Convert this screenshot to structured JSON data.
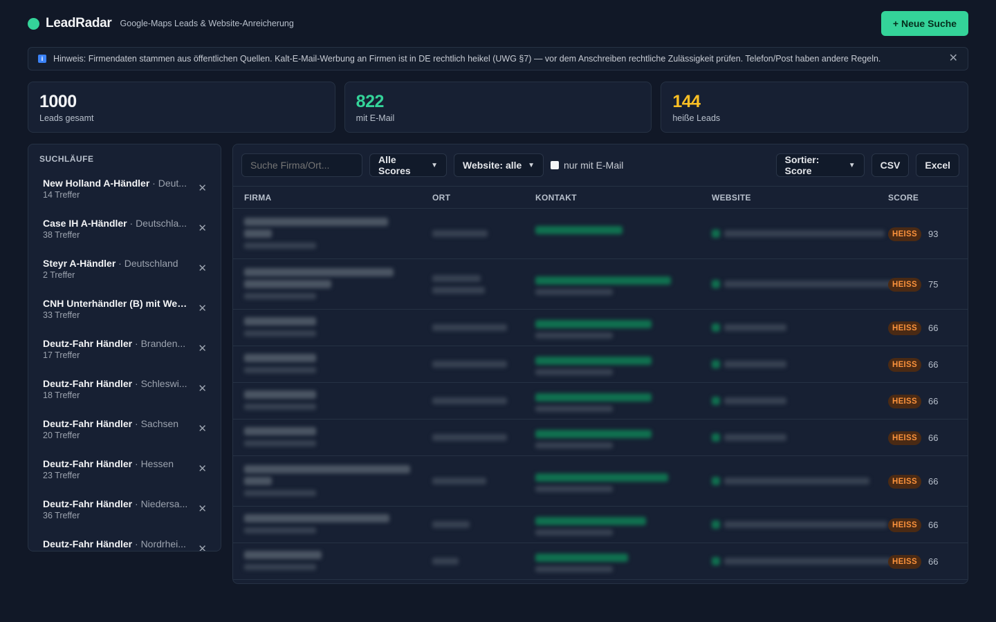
{
  "app": {
    "name": "LeadRadar",
    "subtitle": "Google-Maps Leads & Website-Anreicherung",
    "new_search_label": "+ Neue Suche"
  },
  "notice": {
    "icon": "info-icon",
    "text": "Hinweis: Firmendaten stammen aus öffentlichen Quellen. Kalt-E-Mail-Werbung an Firmen ist in DE rechtlich heikel (UWG §7) — vor dem Anschreiben rechtliche Zulässigkeit prüfen. Telefon/Post haben andere Regeln.",
    "close": "✕"
  },
  "stats": [
    {
      "value": "1000",
      "label": "Leads gesamt",
      "color": "#f3f4f6"
    },
    {
      "value": "822",
      "label": "mit E-Mail",
      "color": "#34d399"
    },
    {
      "value": "144",
      "label": "heiße Leads",
      "color": "#fbbf24"
    }
  ],
  "sidebar": {
    "title": "SUCHLÄUFE",
    "runs": [
      {
        "name": "New Holland A-Händler",
        "region": " · Deut...",
        "count": "14 Treffer"
      },
      {
        "name": "Case IH A-Händler",
        "region": " · Deutschla...",
        "count": "38 Treffer"
      },
      {
        "name": "Steyr A-Händler",
        "region": " · Deutschland",
        "count": "2 Treffer"
      },
      {
        "name": "CNH Unterhändler (B) mit Web...",
        "region": "",
        "count": "33 Treffer"
      },
      {
        "name": "Deutz-Fahr Händler",
        "region": " · Branden...",
        "count": "17 Treffer"
      },
      {
        "name": "Deutz-Fahr Händler",
        "region": " · Schleswi...",
        "count": "18 Treffer"
      },
      {
        "name": "Deutz-Fahr Händler",
        "region": " · Sachsen",
        "count": "20 Treffer"
      },
      {
        "name": "Deutz-Fahr Händler",
        "region": " · Hessen",
        "count": "23 Treffer"
      },
      {
        "name": "Deutz-Fahr Händler",
        "region": " · Niedersa...",
        "count": "36 Treffer"
      },
      {
        "name": "Deutz-Fahr Händler",
        "region": " · Nordrhei...",
        "count": ""
      }
    ]
  },
  "toolbar": {
    "search_placeholder": "Suche Firma/Ort...",
    "score_filter": "Alle Scores",
    "website_filter": "Website: alle",
    "email_only_label": "nur mit E-Mail",
    "sort_label": "Sortier: Score",
    "csv_label": "CSV",
    "excel_label": "Excel"
  },
  "table": {
    "columns": [
      "FIRMA",
      "ORT",
      "KONTAKT",
      "WEBSITE",
      "SCORE"
    ],
    "rows": [
      {
        "badge": "HEISS",
        "score": "93"
      },
      {
        "badge": "HEISS",
        "score": "75"
      },
      {
        "badge": "HEISS",
        "score": "66"
      },
      {
        "badge": "HEISS",
        "score": "66"
      },
      {
        "badge": "HEISS",
        "score": "66"
      },
      {
        "badge": "HEISS",
        "score": "66"
      },
      {
        "badge": "HEISS",
        "score": "66"
      },
      {
        "badge": "HEISS",
        "score": "66"
      },
      {
        "badge": "HEISS",
        "score": "66"
      }
    ]
  }
}
